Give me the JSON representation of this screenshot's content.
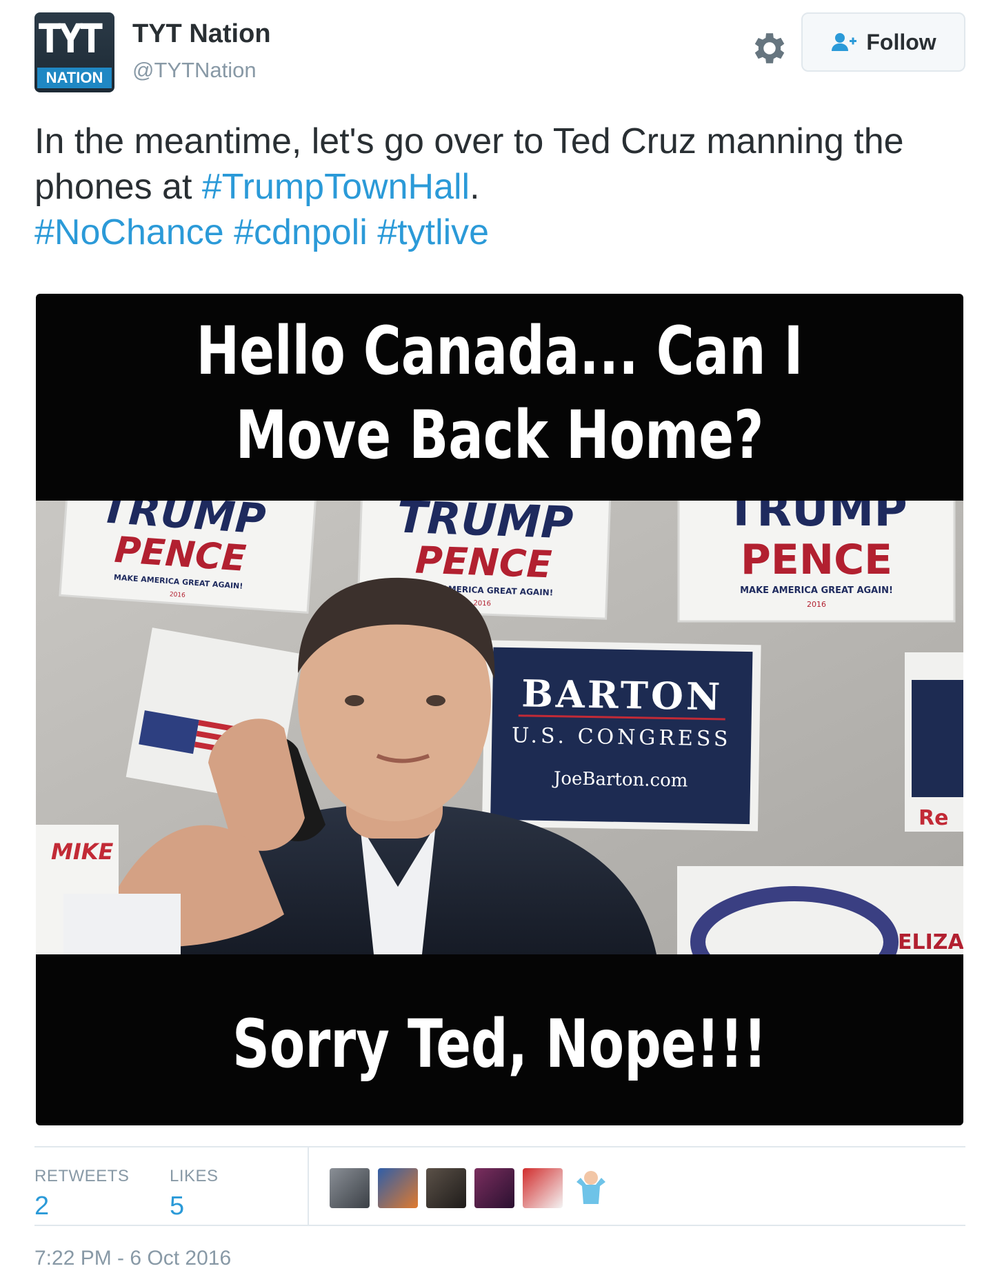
{
  "account": {
    "avatar_top": "TYT",
    "avatar_bottom": "NATION",
    "name": "TYT Nation",
    "handle": "@TYTNation"
  },
  "actions": {
    "follow_label": "Follow"
  },
  "tweet": {
    "text_plain_1": "In the meantime, let's go over to Ted Cruz manning the phones at ",
    "hashtag_1": "#TrumpTownHall",
    "text_plain_2": ".",
    "hashtag_2": "#NoChance",
    "hashtag_3": "#cdnpoli",
    "hashtag_4": "#tytlive"
  },
  "media": {
    "top_caption_line1": "Hello Canada... Can I",
    "top_caption_line2": "Move Back Home?",
    "bottom_caption": "Sorry Ted, Nope!!!",
    "sign_trump": "TRUMP",
    "sign_pence": "PENCE",
    "sign_slogan": "MAKE AMERICA GREAT AGAIN!",
    "sign_year": "2016",
    "barton_name": "BARTON",
    "barton_sub": "U.S. CONGRESS",
    "barton_url": "JoeBarton.com",
    "mike_sign": "MIKE",
    "eliz_sign": "ELIZABE",
    "re_sign": "Re"
  },
  "stats": {
    "retweets_label": "RETWEETS",
    "retweets_value": "2",
    "likes_label": "LIKES",
    "likes_value": "5"
  },
  "likers": [
    "liker-1",
    "liker-2",
    "liker-3",
    "liker-4",
    "liker-5",
    "liker-6"
  ],
  "timestamp": "7:22 PM - 6 Oct 2016",
  "colors": {
    "link": "#2b9ad8",
    "text": "#292f33",
    "muted": "#8899a6",
    "border": "#e1e8ed"
  }
}
